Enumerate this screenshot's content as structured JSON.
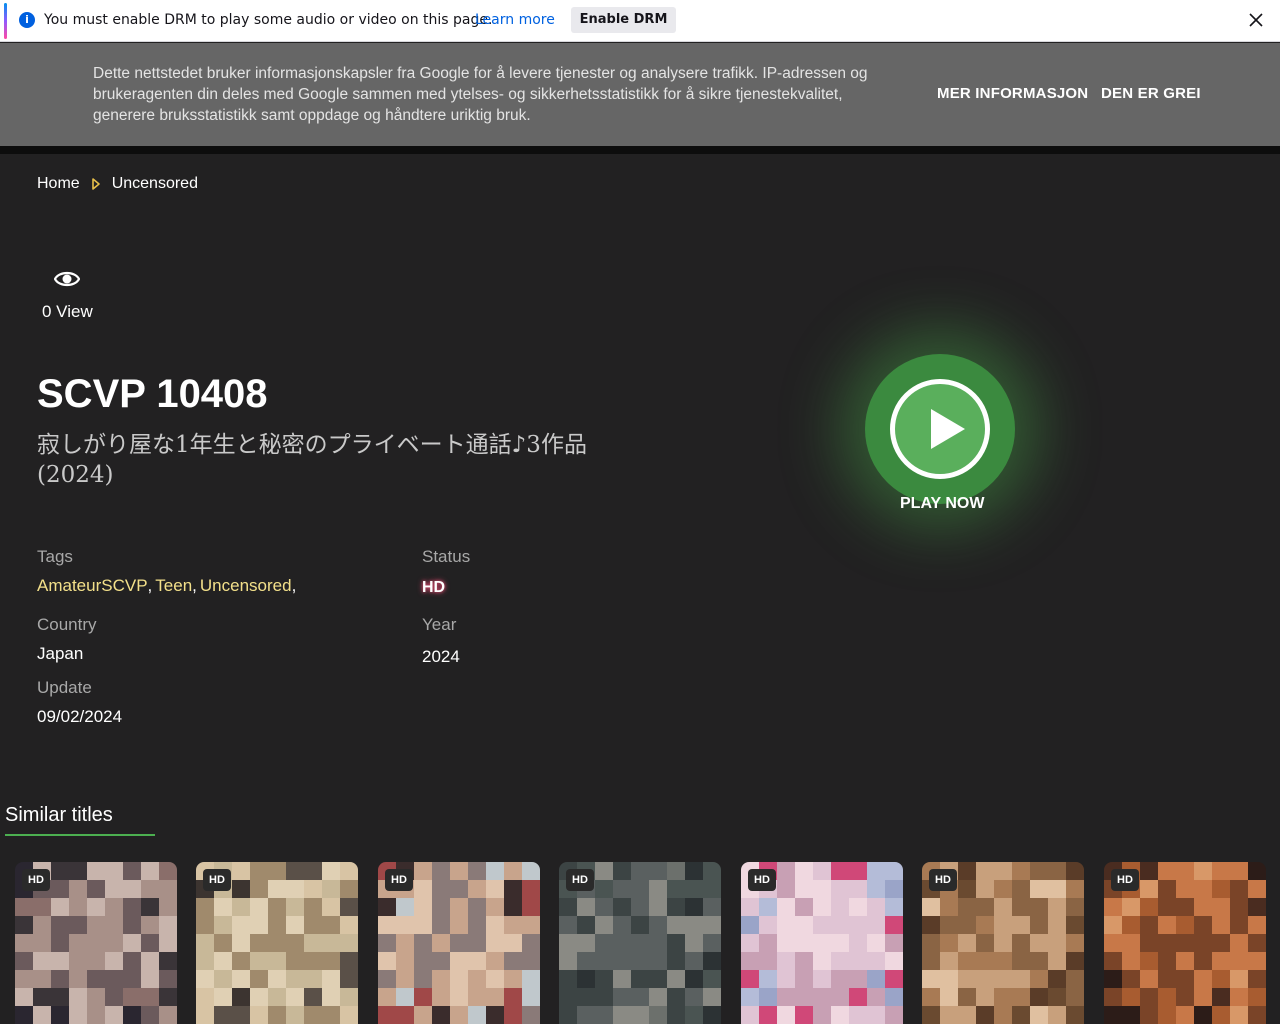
{
  "drm_bar": {
    "message": "You must enable DRM to play some audio or video on this page.",
    "learn_more": "Learn more",
    "enable_button": "Enable DRM"
  },
  "cookie_banner": {
    "text": "Dette nettstedet bruker informasjonskapsler fra Google for å levere tjenester og analysere trafikk. IP-adressen og brukeragenten din deles med Google sammen med ytelses- og sikkerhetsstatistikk for å sikre tjenestekvalitet, generere bruksstatistikk samt oppdage og håndtere uriktig bruk.",
    "more_info": "MER INFORMASJON",
    "accept": "DEN ER GREI"
  },
  "breadcrumb": {
    "home": "Home",
    "current": "Uncensored"
  },
  "views": "0 View",
  "title": "SCVP 10408",
  "subtitle": "寂しがり屋な1年生と秘密のプライベート通話♪3作品 (2024)",
  "meta": {
    "tags_label": "Tags",
    "tags": [
      "AmateurSCVP",
      "Teen",
      "Uncensored"
    ],
    "status_label": "Status",
    "status": "HD",
    "country_label": "Country",
    "country": "Japan",
    "year_label": "Year",
    "year": "2024",
    "update_label": "Update",
    "update": "09/02/2024"
  },
  "play_label": "PLAY NOW",
  "similar": {
    "title": "Similar titles",
    "items": [
      {
        "badge": "HD",
        "palette": [
          "#2a2630",
          "#6b5a5c",
          "#a89088",
          "#c8b4ac",
          "#3a3438",
          "#8a6e6a"
        ]
      },
      {
        "badge": "HD",
        "palette": [
          "#5a5048",
          "#c8b898",
          "#e0d0b4",
          "#a08a6c",
          "#3c3430",
          "#d8c4a4"
        ]
      },
      {
        "badge": "HD",
        "palette": [
          "#3a2c2c",
          "#c8a48c",
          "#e0c4ac",
          "#8a7a78",
          "#a04848",
          "#c0c8cc"
        ]
      },
      {
        "badge": "HD",
        "palette": [
          "#2c3234",
          "#5a6060",
          "#8a8a84",
          "#3c4444",
          "#6c706c",
          "#4a5452"
        ]
      },
      {
        "badge": "HD",
        "palette": [
          "#9aa4c8",
          "#e0c4d4",
          "#f0d8e0",
          "#c8a0b4",
          "#d04878",
          "#b4bcd8"
        ]
      },
      {
        "badge": "HD",
        "palette": [
          "#6a4a30",
          "#a87a54",
          "#c8a07c",
          "#8a6444",
          "#e0c0a0",
          "#5a3c28"
        ]
      },
      {
        "badge": "HD",
        "palette": [
          "#4a2c20",
          "#a85c30",
          "#c87848",
          "#7a4428",
          "#d89868",
          "#2c1c18"
        ]
      }
    ]
  },
  "colors": {
    "background": "#222122",
    "accent_green": "#4caf50",
    "tag_yellow": "#f3e08a"
  }
}
